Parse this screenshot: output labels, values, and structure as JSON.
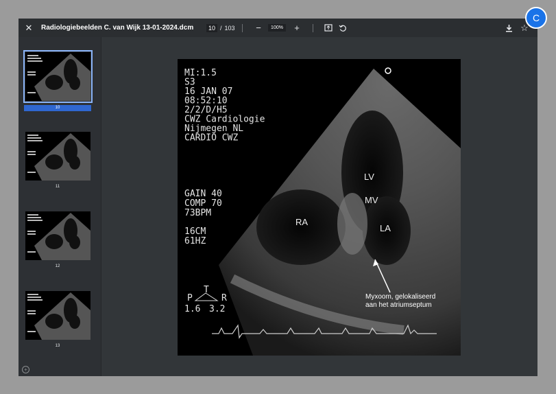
{
  "toolbar": {
    "title": "Radiologiebeelden C. van Wijk 13-01-2024.dcm",
    "current_page": "10",
    "page_separator": "/",
    "total_pages": "103",
    "zoom": "100%",
    "icons": {
      "close": "close-icon",
      "zoom_out": "minus-icon",
      "zoom_in": "plus-icon",
      "fit": "fit-page-icon",
      "rotate": "rotate-icon",
      "download": "download-icon",
      "bookmark": "star-icon"
    }
  },
  "avatar": {
    "initial": "C",
    "color": "#1a73e8"
  },
  "thumbnails": [
    {
      "label": "10",
      "selected": true
    },
    {
      "label": "11",
      "selected": false
    },
    {
      "label": "12",
      "selected": false
    },
    {
      "label": "13",
      "selected": false
    }
  ],
  "image": {
    "header_lines": [
      "MI:1.5",
      "S3",
      "16 JAN  07",
      "08:52:10",
      "2/2/D/H5",
      "CWZ Cardiologie",
      "Nijmegen NL",
      "CARDIO CWZ"
    ],
    "settings_lines": [
      "GAIN 40",
      "COMP 70",
      "73BPM"
    ],
    "depth_lines": [
      "16CM",
      "61HZ"
    ],
    "probe_lines": [
      "P",
      "T",
      "R",
      "1.6",
      "3.2"
    ],
    "labels": {
      "lv": "LV",
      "mv": "MV",
      "ra": "RA",
      "la": "LA"
    },
    "annotation_line1": "Myxoom, gelokaliseerd",
    "annotation_line2": "aan het atriumseptum"
  },
  "colors": {
    "accent": "#8ab4f8",
    "selected_label": "#2f67d0"
  }
}
